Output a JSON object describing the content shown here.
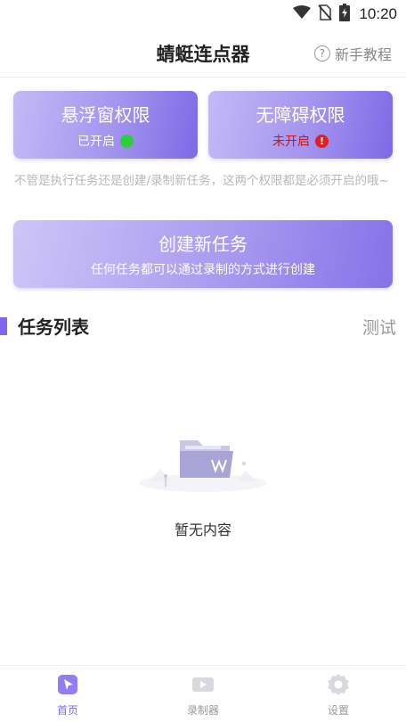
{
  "status_bar": {
    "time": "10:20",
    "icons": [
      "wifi-icon",
      "no-sim-icon",
      "battery-charging-icon"
    ]
  },
  "header": {
    "title": "蜻蜓连点器",
    "tutorial_label": "新手教程",
    "tutorial_icon": "help-circle-icon"
  },
  "permissions": {
    "floating": {
      "title": "悬浮窗权限",
      "status": "已开启",
      "status_color": "#2ecc40"
    },
    "accessibility": {
      "title": "无障碍权限",
      "status": "未开启",
      "status_color": "#e02020"
    }
  },
  "hint": "不管是执行任务还是创建/录制新任务，这两个权限都是必须开启的哦~",
  "create_task": {
    "title": "创建新任务",
    "subtitle": "任何任务都可以通过录制的方式进行创建"
  },
  "task_list": {
    "title": "任务列表",
    "test_label": "测试",
    "empty_text": "暂无内容",
    "empty_icon": "empty-folder-icon"
  },
  "bottom_nav": {
    "items": [
      {
        "label": "首页",
        "icon": "home-cursor-icon",
        "active": true
      },
      {
        "label": "录制器",
        "icon": "video-recorder-icon",
        "active": false
      },
      {
        "label": "设置",
        "icon": "gear-icon",
        "active": false
      }
    ]
  },
  "colors": {
    "accent": "#7b68ee",
    "card_gradient_start": "#c3baf6",
    "card_gradient_end": "#7d6ae6"
  }
}
